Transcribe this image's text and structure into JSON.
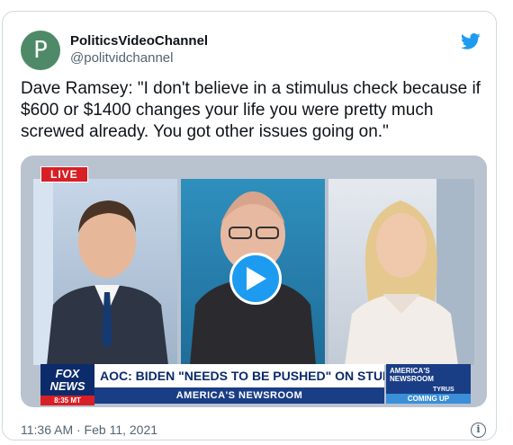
{
  "tweet": {
    "author_initial": "P",
    "display_name": "PoliticsVideoChannel",
    "handle": "@politvidchannel",
    "text": "Dave Ramsey: \"I don't believe in a stimulus check because if $600 or $1400 changes your life you were pretty much screwed already. You got other issues going on.\"",
    "timestamp": "11:36 AM · Feb 11, 2021",
    "info_icon_label": "i"
  },
  "video": {
    "live_badge": "LIVE",
    "network_logo_top": "FOX",
    "network_logo_bottom": "NEWS",
    "clock": "8:35 MT",
    "headline": "AOC: BIDEN \"NEEDS TO BE PUSHED\" ON STUDENT DEBT",
    "show_name": "AMERICA'S NEWSROOM",
    "promo_show": "AMERICA'S NEWSROOM",
    "promo_guest": "TYRUS",
    "promo_status": "COMING UP",
    "play_icon": "play-icon"
  },
  "colors": {
    "accent": "#1d9bf0",
    "avatar_bg": "#4f8a68",
    "fox_blue": "#0c2b6b",
    "live_red": "#d81f26"
  }
}
